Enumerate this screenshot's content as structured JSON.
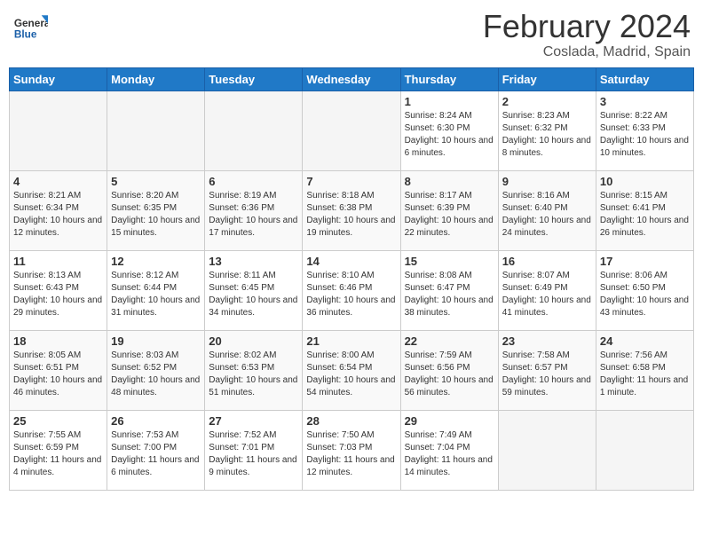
{
  "header": {
    "logo_general": "General",
    "logo_blue": "Blue",
    "month": "February 2024",
    "location": "Coslada, Madrid, Spain"
  },
  "weekdays": [
    "Sunday",
    "Monday",
    "Tuesday",
    "Wednesday",
    "Thursday",
    "Friday",
    "Saturday"
  ],
  "weeks": [
    [
      {
        "day": "",
        "info": ""
      },
      {
        "day": "",
        "info": ""
      },
      {
        "day": "",
        "info": ""
      },
      {
        "day": "",
        "info": ""
      },
      {
        "day": "1",
        "info": "Sunrise: 8:24 AM\nSunset: 6:30 PM\nDaylight: 10 hours\nand 6 minutes."
      },
      {
        "day": "2",
        "info": "Sunrise: 8:23 AM\nSunset: 6:32 PM\nDaylight: 10 hours\nand 8 minutes."
      },
      {
        "day": "3",
        "info": "Sunrise: 8:22 AM\nSunset: 6:33 PM\nDaylight: 10 hours\nand 10 minutes."
      }
    ],
    [
      {
        "day": "4",
        "info": "Sunrise: 8:21 AM\nSunset: 6:34 PM\nDaylight: 10 hours\nand 12 minutes."
      },
      {
        "day": "5",
        "info": "Sunrise: 8:20 AM\nSunset: 6:35 PM\nDaylight: 10 hours\nand 15 minutes."
      },
      {
        "day": "6",
        "info": "Sunrise: 8:19 AM\nSunset: 6:36 PM\nDaylight: 10 hours\nand 17 minutes."
      },
      {
        "day": "7",
        "info": "Sunrise: 8:18 AM\nSunset: 6:38 PM\nDaylight: 10 hours\nand 19 minutes."
      },
      {
        "day": "8",
        "info": "Sunrise: 8:17 AM\nSunset: 6:39 PM\nDaylight: 10 hours\nand 22 minutes."
      },
      {
        "day": "9",
        "info": "Sunrise: 8:16 AM\nSunset: 6:40 PM\nDaylight: 10 hours\nand 24 minutes."
      },
      {
        "day": "10",
        "info": "Sunrise: 8:15 AM\nSunset: 6:41 PM\nDaylight: 10 hours\nand 26 minutes."
      }
    ],
    [
      {
        "day": "11",
        "info": "Sunrise: 8:13 AM\nSunset: 6:43 PM\nDaylight: 10 hours\nand 29 minutes."
      },
      {
        "day": "12",
        "info": "Sunrise: 8:12 AM\nSunset: 6:44 PM\nDaylight: 10 hours\nand 31 minutes."
      },
      {
        "day": "13",
        "info": "Sunrise: 8:11 AM\nSunset: 6:45 PM\nDaylight: 10 hours\nand 34 minutes."
      },
      {
        "day": "14",
        "info": "Sunrise: 8:10 AM\nSunset: 6:46 PM\nDaylight: 10 hours\nand 36 minutes."
      },
      {
        "day": "15",
        "info": "Sunrise: 8:08 AM\nSunset: 6:47 PM\nDaylight: 10 hours\nand 38 minutes."
      },
      {
        "day": "16",
        "info": "Sunrise: 8:07 AM\nSunset: 6:49 PM\nDaylight: 10 hours\nand 41 minutes."
      },
      {
        "day": "17",
        "info": "Sunrise: 8:06 AM\nSunset: 6:50 PM\nDaylight: 10 hours\nand 43 minutes."
      }
    ],
    [
      {
        "day": "18",
        "info": "Sunrise: 8:05 AM\nSunset: 6:51 PM\nDaylight: 10 hours\nand 46 minutes."
      },
      {
        "day": "19",
        "info": "Sunrise: 8:03 AM\nSunset: 6:52 PM\nDaylight: 10 hours\nand 48 minutes."
      },
      {
        "day": "20",
        "info": "Sunrise: 8:02 AM\nSunset: 6:53 PM\nDaylight: 10 hours\nand 51 minutes."
      },
      {
        "day": "21",
        "info": "Sunrise: 8:00 AM\nSunset: 6:54 PM\nDaylight: 10 hours\nand 54 minutes."
      },
      {
        "day": "22",
        "info": "Sunrise: 7:59 AM\nSunset: 6:56 PM\nDaylight: 10 hours\nand 56 minutes."
      },
      {
        "day": "23",
        "info": "Sunrise: 7:58 AM\nSunset: 6:57 PM\nDaylight: 10 hours\nand 59 minutes."
      },
      {
        "day": "24",
        "info": "Sunrise: 7:56 AM\nSunset: 6:58 PM\nDaylight: 11 hours\nand 1 minute."
      }
    ],
    [
      {
        "day": "25",
        "info": "Sunrise: 7:55 AM\nSunset: 6:59 PM\nDaylight: 11 hours\nand 4 minutes."
      },
      {
        "day": "26",
        "info": "Sunrise: 7:53 AM\nSunset: 7:00 PM\nDaylight: 11 hours\nand 6 minutes."
      },
      {
        "day": "27",
        "info": "Sunrise: 7:52 AM\nSunset: 7:01 PM\nDaylight: 11 hours\nand 9 minutes."
      },
      {
        "day": "28",
        "info": "Sunrise: 7:50 AM\nSunset: 7:03 PM\nDaylight: 11 hours\nand 12 minutes."
      },
      {
        "day": "29",
        "info": "Sunrise: 7:49 AM\nSunset: 7:04 PM\nDaylight: 11 hours\nand 14 minutes."
      },
      {
        "day": "",
        "info": ""
      },
      {
        "day": "",
        "info": ""
      }
    ]
  ]
}
